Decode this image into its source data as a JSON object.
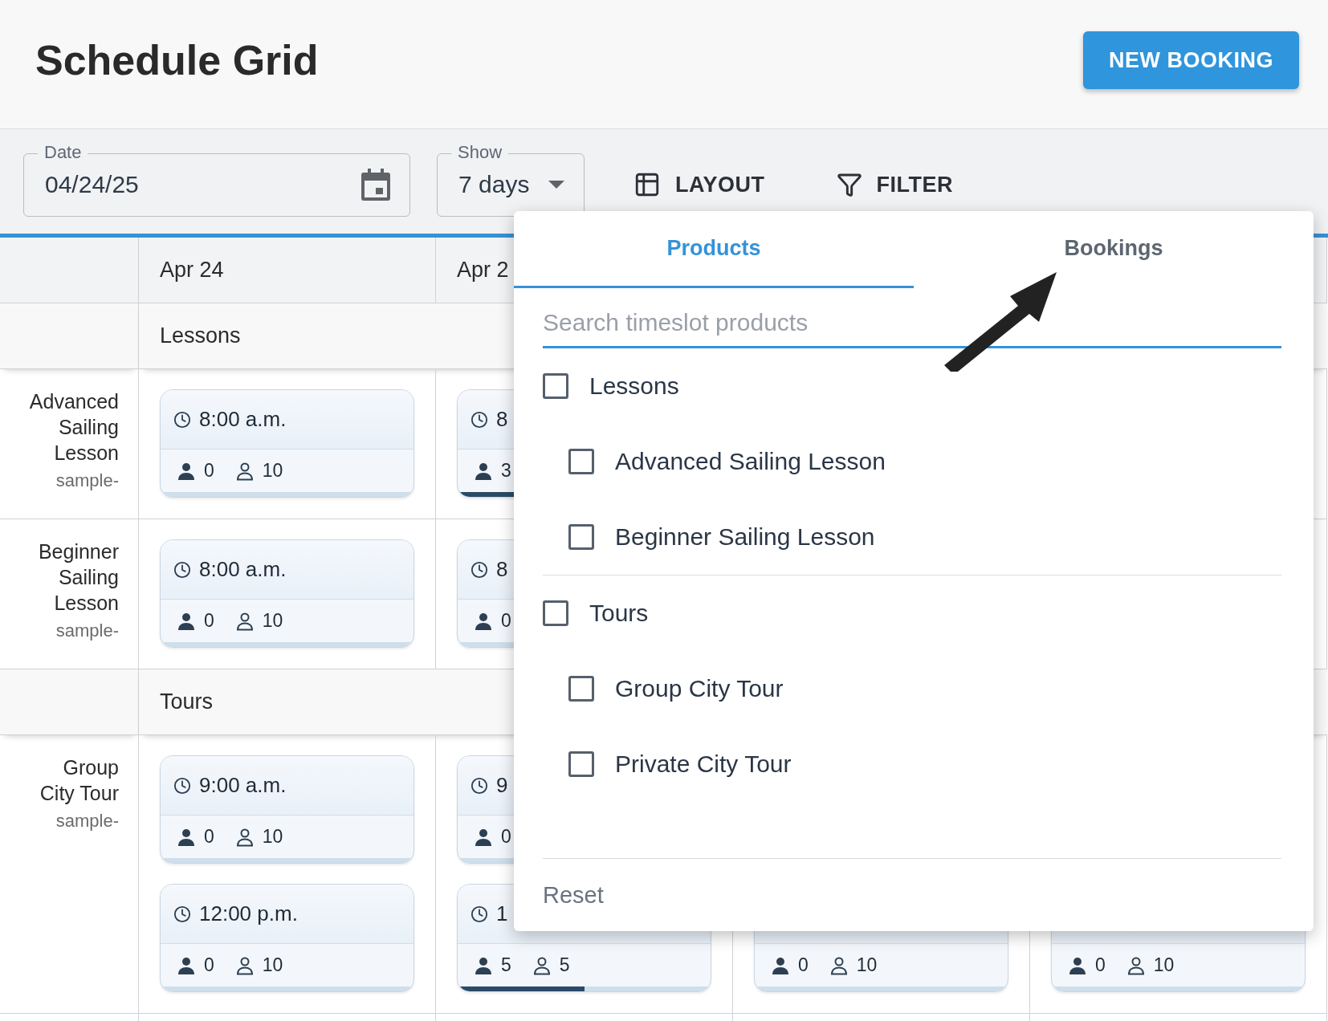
{
  "header": {
    "title": "Schedule Grid",
    "new_booking_button": "NEW BOOKING"
  },
  "toolbar": {
    "date_field": {
      "label": "Date",
      "value": "04/24/25"
    },
    "show_field": {
      "label": "Show",
      "value": "7 days"
    },
    "layout_button": "LAYOUT",
    "filter_button": "FILTER"
  },
  "grid": {
    "columns": [
      "Apr 24",
      "Apr 2"
    ],
    "groups": [
      {
        "label": "Lessons",
        "products": [
          {
            "name": "Advanced Sailing Lesson",
            "code": "sample-",
            "cells": [
              [
                {
                  "time": "8:00 a.m.",
                  "booked": "0",
                  "available": "10"
                }
              ],
              [
                {
                  "time": "8",
                  "booked": "3",
                  "level": 0.3
                }
              ]
            ]
          },
          {
            "name": "Beginner Sailing Lesson",
            "code": "sample-",
            "cells": [
              [
                {
                  "time": "8:00 a.m.",
                  "booked": "0",
                  "available": "10"
                }
              ],
              [
                {
                  "time": "8",
                  "booked": "0"
                }
              ]
            ]
          }
        ]
      },
      {
        "label": "Tours",
        "products": [
          {
            "name": "Group City Tour",
            "code": "sample-",
            "cells": [
              [
                {
                  "time": "9:00 a.m.",
                  "booked": "0",
                  "available": "10"
                },
                {
                  "time": "12:00 p.m.",
                  "booked": "0",
                  "available": "10"
                }
              ],
              [
                {
                  "time": "9",
                  "booked": "0"
                },
                {
                  "time": "1",
                  "booked": "5",
                  "available": "5",
                  "level": 0.5
                }
              ],
              [
                {
                  "booked": "0",
                  "available": "10"
                }
              ],
              [
                {
                  "booked": "0",
                  "available": "10"
                }
              ]
            ]
          }
        ]
      }
    ]
  },
  "filter_popup": {
    "tabs": [
      {
        "label": "Products",
        "selected": true
      },
      {
        "label": "Bookings",
        "selected": false
      }
    ],
    "search": {
      "placeholder": "Search timeslot products"
    },
    "categories": [
      {
        "label": "Lessons",
        "checked": false,
        "children": [
          {
            "label": "Advanced Sailing Lesson",
            "checked": false
          },
          {
            "label": "Beginner Sailing Lesson",
            "checked": false
          }
        ]
      },
      {
        "label": "Tours",
        "checked": false,
        "children": [
          {
            "label": "Group City Tour",
            "checked": false
          },
          {
            "label": "Private City Tour",
            "checked": false
          }
        ]
      }
    ],
    "reset_button": "Reset"
  }
}
